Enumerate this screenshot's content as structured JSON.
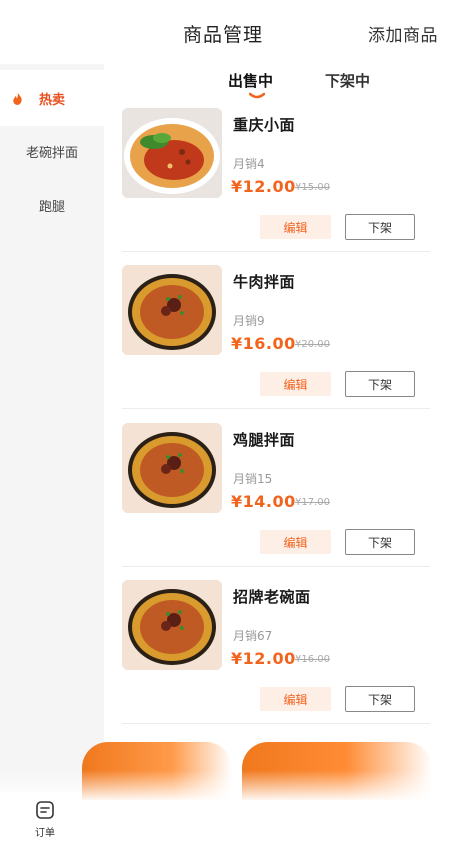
{
  "header": {
    "title": "商品管理",
    "add_label": "添加商品"
  },
  "sidebar": {
    "items": [
      {
        "label": "热卖",
        "icon": "fire-icon"
      },
      {
        "label": "老碗拌面"
      },
      {
        "label": "跑腿"
      }
    ]
  },
  "tabs": [
    {
      "label": "出售中"
    },
    {
      "label": "下架中"
    }
  ],
  "products": [
    {
      "name": "重庆小面",
      "sales": "月销4",
      "price": "¥12.00",
      "old_price": "¥15.00",
      "edit": "编辑",
      "off": "下架"
    },
    {
      "name": "牛肉拌面",
      "sales": "月销9",
      "price": "¥16.00",
      "old_price": "¥20.00",
      "edit": "编辑",
      "off": "下架"
    },
    {
      "name": "鸡腿拌面",
      "sales": "月销15",
      "price": "¥14.00",
      "old_price": "¥17.00",
      "edit": "编辑",
      "off": "下架"
    },
    {
      "name": "招牌老碗面",
      "sales": "月销67",
      "price": "¥12.00",
      "old_price": "¥16.00",
      "edit": "编辑",
      "off": "下架"
    }
  ],
  "bottom_nav": {
    "order_label": "订单",
    "order_icon": "order-list-icon"
  },
  "colors": {
    "accent": "#f2641e",
    "sidebar_bg": "#f5f5f5"
  }
}
